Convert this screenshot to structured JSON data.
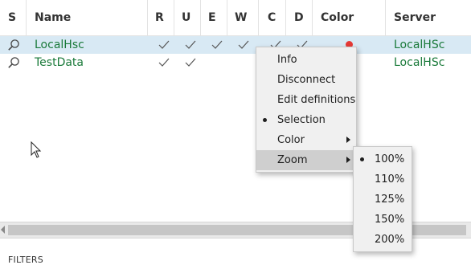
{
  "table": {
    "headers": {
      "s": "S",
      "name": "Name",
      "r": "R",
      "u": "U",
      "e": "E",
      "w": "W",
      "c": "C",
      "d": "D",
      "color": "Color",
      "server": "Server"
    },
    "rows": [
      {
        "name": "LocalHsc",
        "server": "LocalHSc",
        "checks": {
          "r": true,
          "u": true,
          "e": true,
          "w": true,
          "c": true,
          "d": true
        },
        "color": "#e53935",
        "selected": true
      },
      {
        "name": "TestData",
        "server": "LocalHSc",
        "checks": {
          "r": true,
          "u": true,
          "e": false,
          "w": false,
          "c": false,
          "d": false
        },
        "selected": false
      }
    ]
  },
  "context_menu": {
    "items": [
      {
        "label": "Info"
      },
      {
        "label": "Disconnect"
      },
      {
        "label": "Edit definitions"
      },
      {
        "label": "Selection",
        "checked": true
      },
      {
        "label": "Color",
        "submenu": true
      },
      {
        "label": "Zoom",
        "submenu": true,
        "highlighted": true
      }
    ]
  },
  "zoom_menu": {
    "items": [
      {
        "label": "100%",
        "checked": true
      },
      {
        "label": "110%"
      },
      {
        "label": "125%"
      },
      {
        "label": "150%"
      },
      {
        "label": "200%"
      }
    ]
  },
  "footer": {
    "filters_label": "FILTERS"
  },
  "icons": {
    "search": "search-icon",
    "check": "check-icon",
    "cursor": "mouse-cursor-icon",
    "submenu": "submenu-arrow-icon"
  },
  "colors": {
    "name_green": "#1a7a3a",
    "selection_bg": "#d8e9f4",
    "menu_bg": "#f0f0f0",
    "highlight_bg": "#cfcfcf",
    "status_red": "#e53935"
  }
}
